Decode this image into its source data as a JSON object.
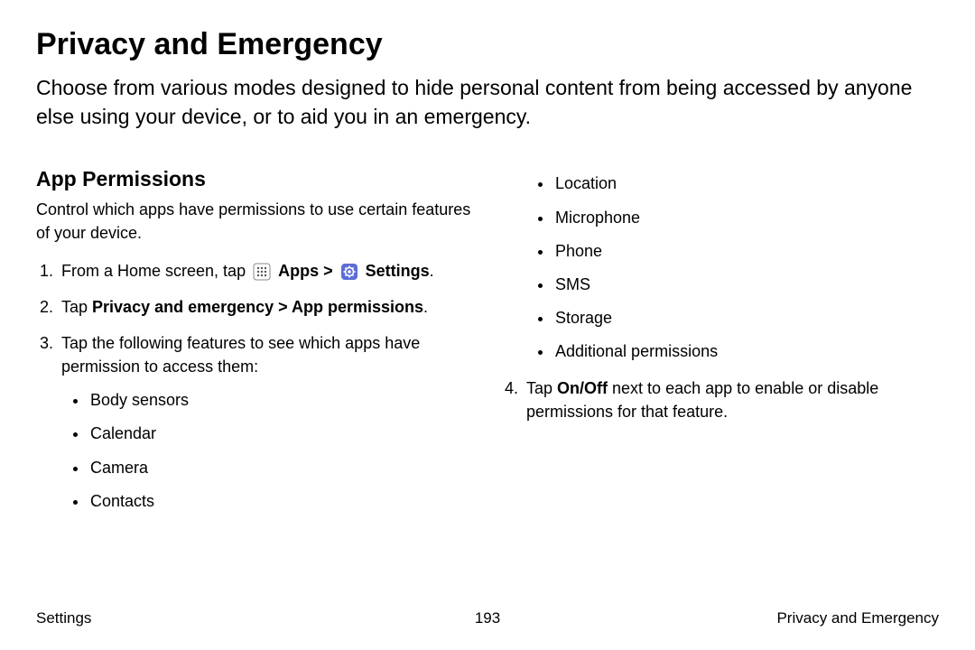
{
  "title": "Privacy and Emergency",
  "intro": "Choose from various modes designed to hide personal content from being accessed by anyone else using your device, or to aid you in an emergency.",
  "section": {
    "title": "App Permissions",
    "intro": "Control which apps have permissions to use certain features of your device."
  },
  "steps_col1": {
    "s1_pre": "From a Home screen, tap ",
    "s1_apps": "Apps",
    "s1_sep": " > ",
    "s1_settings": "Settings",
    "s1_end": ".",
    "s2_pre": "Tap ",
    "s2_bold": "Privacy and emergency > App permissions",
    "s2_end": ".",
    "s3": "Tap the following features to see which apps have permission to access them:",
    "bullets": [
      "Body sensors",
      "Calendar",
      "Camera",
      "Contacts"
    ]
  },
  "col2": {
    "bullets": [
      "Location",
      "Microphone",
      "Phone",
      "SMS",
      "Storage",
      "Additional permissions"
    ],
    "s4_pre": "Tap ",
    "s4_bold": "On/Off",
    "s4_post": " next to each app to enable or disable permissions for that feature."
  },
  "footer": {
    "left": "Settings",
    "center": "193",
    "right": "Privacy and Emergency"
  }
}
